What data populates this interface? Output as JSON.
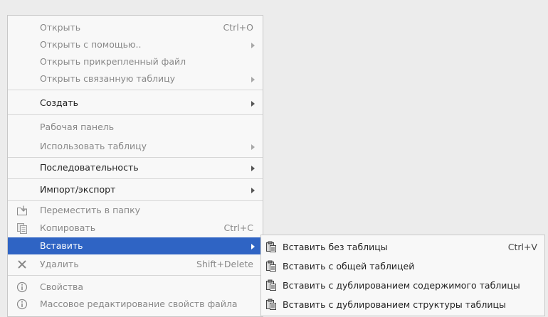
{
  "context_menu": {
    "items": [
      {
        "label": "Открыть",
        "shortcut": "Ctrl+O"
      },
      {
        "label": "Открыть с помощью..",
        "has_submenu": true
      },
      {
        "label": "Открыть прикрепленный файл"
      },
      {
        "label": "Открыть связанную таблицу",
        "has_submenu": true
      },
      {
        "label": "Создать",
        "has_submenu": true,
        "enabled": true
      },
      {
        "label": "Рабочая панель"
      },
      {
        "label": "Использовать таблицу",
        "has_submenu": true
      },
      {
        "label": "Последовательность",
        "has_submenu": true,
        "enabled": true
      },
      {
        "label": "Импорт/экспорт",
        "has_submenu": true,
        "enabled": true
      },
      {
        "label": "Переместить в папку",
        "icon": "move-to-folder-icon"
      },
      {
        "label": "Копировать",
        "shortcut": "Ctrl+C",
        "icon": "copy-icon"
      },
      {
        "label": "Вставить",
        "has_submenu": true,
        "selected": true
      },
      {
        "label": "Удалить",
        "shortcut": "Shift+Delete",
        "icon": "delete-x-icon"
      },
      {
        "label": "Свойства",
        "icon": "info-icon"
      },
      {
        "label": "Массовое редактирование свойств файла",
        "icon": "info-icon"
      }
    ]
  },
  "paste_submenu": {
    "items": [
      {
        "label": "Вставить без таблицы",
        "shortcut": "Ctrl+V",
        "icon": "paste-icon"
      },
      {
        "label": "Вставить с общей таблицей",
        "icon": "paste-icon"
      },
      {
        "label": "Вставить с дублированием содержимого таблицы",
        "icon": "paste-icon"
      },
      {
        "label": "Вставить с дублированием структуры таблицы",
        "icon": "paste-icon"
      }
    ]
  },
  "colors": {
    "selection": "#2f64c4",
    "menu_background": "#f8f8f8",
    "disabled_text": "#888888"
  }
}
